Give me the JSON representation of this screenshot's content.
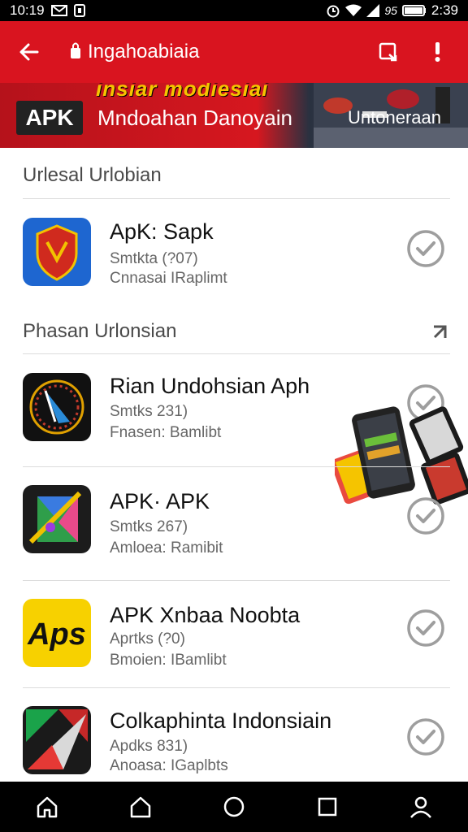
{
  "status_bar": {
    "time": "10:19",
    "battery": "95",
    "right_time": "2:39"
  },
  "app_bar": {
    "title": "Ingahoabiaia"
  },
  "banner": {
    "top_text": "insiar modiesiai",
    "apk_badge": "APK",
    "main_text": "Mndoahan Danoyain",
    "right_text": "Untoneraan"
  },
  "sections": [
    {
      "title": "Urlesal Urlobian"
    },
    {
      "title": "Phasan Urlonsian"
    }
  ],
  "apps": [
    {
      "name": "ApK: Sapk",
      "meta1": "Smtkta (?07)",
      "meta2": "Cnnasai IRaplimt"
    },
    {
      "name": "Rian Undohsian Aph",
      "meta1": "Smtks 231)",
      "meta2": "Fnasen: Bamlibt"
    },
    {
      "name": "APK· APK",
      "meta1": "Smtks 267)",
      "meta2": "Amloea: Ramibit"
    },
    {
      "name": "APK Xnbaa Noobta",
      "meta1": "Aprtks (?0)",
      "meta2": "Bmoien: IBamlibt"
    },
    {
      "name": "Colkaphinta Indonsiain",
      "meta1": "Apdks 831)",
      "meta2": "Anoasa: IGaplbts"
    }
  ],
  "colors": {
    "brand_red": "#d9141f",
    "check_gray": "#9e9e9e"
  }
}
